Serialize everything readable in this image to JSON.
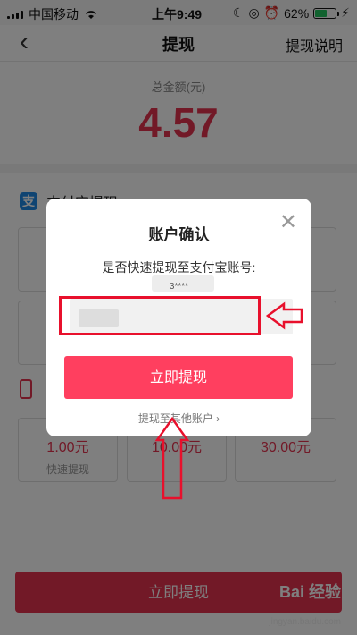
{
  "status_bar": {
    "carrier": "中国移动",
    "time": "上午9:49",
    "battery": "62%",
    "battery_level": 0.62
  },
  "nav": {
    "title": "提现",
    "help": "提现说明"
  },
  "balance": {
    "label": "总金额(元)",
    "value": "4.57"
  },
  "alipay_section": {
    "title": "支付宝提现"
  },
  "options": [
    {
      "value": "1.00元",
      "sub": "快速提现"
    },
    {
      "value": "10.00元"
    },
    {
      "value": "30.00元"
    }
  ],
  "bottom_button": "立即提现",
  "dialog": {
    "title": "账户确认",
    "question": "是否快速提现至支付宝账号:",
    "account_masked": "3****",
    "confirm_button": "立即提现",
    "other_link": "提现至其他账户 ›"
  },
  "watermark": {
    "brand": "Bai 经验",
    "url": "jingyan.baidu.com"
  },
  "colors": {
    "accent": "#e4334f",
    "annotation": "#e8102c"
  }
}
